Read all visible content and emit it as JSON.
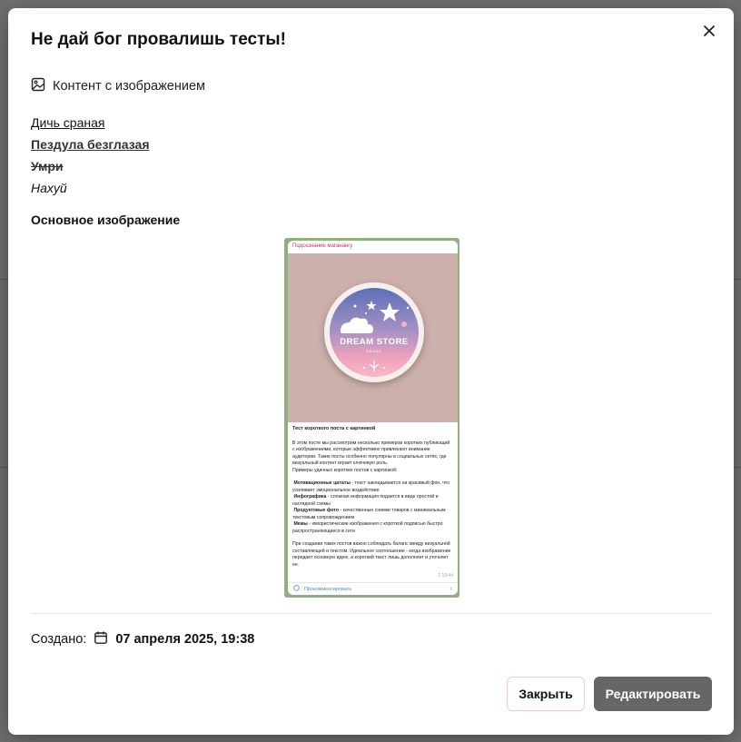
{
  "modal": {
    "title": "Не дай бог провалишь тесты!",
    "content_type_label": "Контент с изображением",
    "rich_text": {
      "line1": "Дичь сраная",
      "line2": "Пездула безглазая",
      "line3": "Умри",
      "line4": "Нахуй"
    },
    "image_section_title": "Основное изображение",
    "image_preview": {
      "channel_label": "Подсознание маганангу",
      "brand_name": "DREAM STORE",
      "brand_sub": "BRAND",
      "post_title": "Тест короткого поста с картинкой",
      "post_p1": "В этом посте мы рассмотрим несколько примеров коротких публикаций с изображениями, которые эффективно привлекают внимание аудитории. Такие посты особенно популярны в социальных сетях, где визуальный контент играет ключевую роль.",
      "post_p2": "Примеры удачных коротких постов с картинкой:",
      "b1_title": "Мотивационные цитаты",
      "b1_text": " - текст накладывается на красивый фон, что усиливает эмоциональное воздействие",
      "b2_title": "Инфографика",
      "b2_text": " - сложная информация подается в виде простой и наглядной схемы",
      "b3_title": "Продуктовые фото",
      "b3_text": " - качественные снимки товаров с минимальным текстовым сопровождением",
      "b4_title": "Мемы",
      "b4_text": " - юмористические изображения с короткой подписью быстро распространяющиеся в сети",
      "post_p3": "При создании таких постов важно соблюдать баланс между визуальной составляющей и текстом. Идеальное соотношение - когда изображение передает основную идею, а короткий текст лишь дополняет и уточняет ее.",
      "meta": "2  19:44",
      "comment_label": "Прокомментировать"
    },
    "created_label": "Создано:",
    "created_date": "07 апреля 2025, 19:38",
    "close_button": "Закрыть",
    "edit_button": "Редактировать"
  },
  "icons": {
    "close": "close-icon",
    "image": "image-icon",
    "calendar": "calendar-icon"
  },
  "colors": {
    "overlay": "#6f6f6f",
    "primary_button": "#666666",
    "secondary_border": "#f1c9d0"
  }
}
